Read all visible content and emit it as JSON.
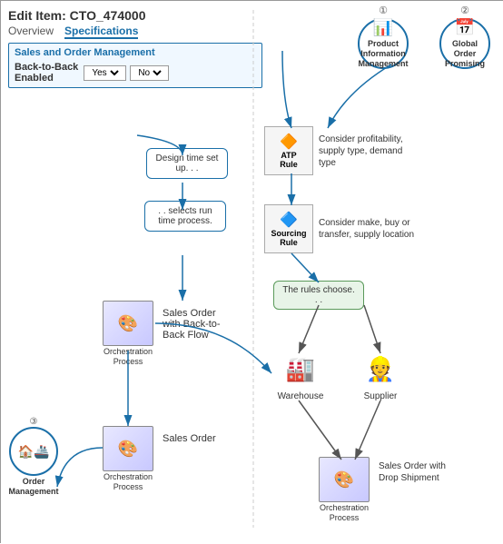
{
  "header": {
    "edit_item_label": "Edit Item:",
    "item_code": "CTO_474000",
    "tab_overview": "Overview",
    "tab_specifications": "Specifications"
  },
  "circles": {
    "top": [
      {
        "number": "1",
        "label": "Product Information Management",
        "icon": "📊"
      },
      {
        "number": "2",
        "label": "Global Order Promising",
        "icon": "📅"
      }
    ],
    "bottom": {
      "number": "3",
      "label": "Order Management",
      "icon": "🏠"
    }
  },
  "sales_order_management": {
    "title": "Sales and Order Management",
    "btb_label": "Back-to-Back\nEnabled",
    "option_yes": "Yes",
    "option_no": "No"
  },
  "bubbles": {
    "design_time": "Design time set up. . .",
    "selects_run_time": ". . selects run time process.",
    "rules_choose": "The rules choose. . ."
  },
  "rules": [
    {
      "id": "atp",
      "label": "ATP\nRule",
      "icon": "🔶",
      "description": "Consider profitability, supply type, demand type"
    },
    {
      "id": "sourcing",
      "label": "Sourcing\nRule",
      "icon": "🔷",
      "description": "Consider make, buy or transfer, supply location"
    }
  ],
  "orchestration_boxes": [
    {
      "id": "orch1",
      "label": "Orchestration\nProcess",
      "desc": "Sales Order\nwith Back-to-\nBack Flow"
    },
    {
      "id": "orch2",
      "label": "Orchestration\nProcess",
      "desc": "Sales Order"
    },
    {
      "id": "orch3",
      "label": "Orchestration\nProcess",
      "desc": "Sales Order with\nDrop Shipment"
    }
  ],
  "supply_nodes": [
    {
      "id": "warehouse",
      "label": "Warehouse",
      "icon": "🏭"
    },
    {
      "id": "supplier",
      "label": "Supplier",
      "icon": "👷"
    }
  ]
}
